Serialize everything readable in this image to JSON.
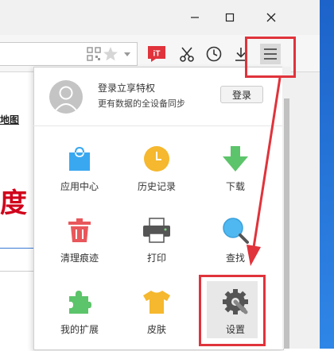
{
  "account": {
    "title": "登录立享特权",
    "subtitle": "更有数据的全设备同步",
    "login_button": "登录"
  },
  "page_fragments": {
    "map_link": "地图",
    "logo_char": "度"
  },
  "menu_items": [
    {
      "label": "应用中心",
      "icon": "shopping-bag-icon"
    },
    {
      "label": "历史记录",
      "icon": "clock-icon"
    },
    {
      "label": "下载",
      "icon": "download-arrow-icon"
    },
    {
      "label": "清理痕迹",
      "icon": "trash-icon"
    },
    {
      "label": "打印",
      "icon": "printer-icon"
    },
    {
      "label": "查找",
      "icon": "magnifier-icon"
    },
    {
      "label": "我的扩展",
      "icon": "puzzle-icon"
    },
    {
      "label": "皮肤",
      "icon": "tshirt-icon"
    },
    {
      "label": "设置",
      "icon": "gear-icon"
    }
  ],
  "toolbar": {
    "icons": [
      "qr-code-icon",
      "star-icon",
      "translate-icon",
      "scissors-icon",
      "clock-icon",
      "download-icon",
      "menu-icon"
    ],
    "translate_icon_text": "iT"
  },
  "colors": {
    "highlight": "#e0333b",
    "bag": "#3aa8f0",
    "clock": "#f5b82e",
    "download": "#5cc46a",
    "trash": "#e8575b",
    "magnifier": "#4fb8f0",
    "puzzle": "#5cc46a",
    "tshirt": "#f5b82e"
  }
}
